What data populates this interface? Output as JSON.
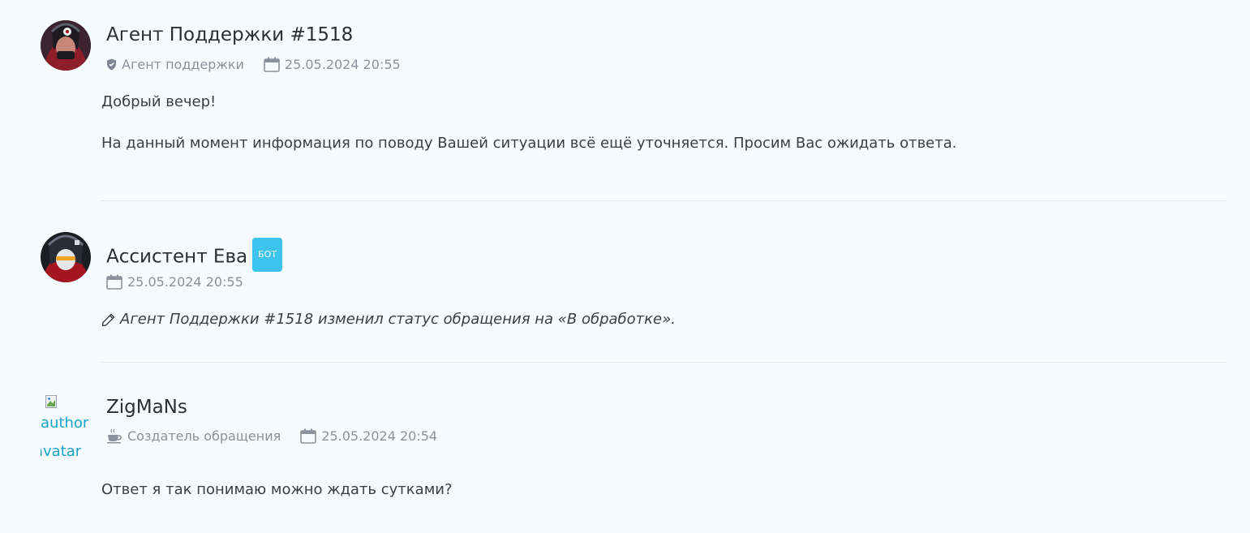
{
  "messages": [
    {
      "author": "Агент Поддержки #1518",
      "role": "Агент поддержки",
      "role_icon": "shield-icon",
      "date": "25.05.2024 20:55",
      "body": [
        "Добрый вечер!",
        "На данный момент информация по поводу Вашей ситуации всё ещё уточняется. Просим Вас ожидать ответа."
      ]
    },
    {
      "author": "Ассистент Ева",
      "badge": "БОТ",
      "date": "25.05.2024 20:55",
      "body": [
        "Агент Поддержки #1518 изменил статус обращения на «В обработке»."
      ]
    },
    {
      "author": "ZigMaNs",
      "role": "Создатель обращения",
      "role_icon": "coffee-icon",
      "date": "25.05.2024 20:54",
      "avatar_alt": [
        "author",
        "avatar"
      ],
      "body": [
        "Ответ я так понимаю можно ждать сутками?"
      ]
    }
  ],
  "colors": {
    "background": "#f6fbfd",
    "bot_badge": "#3cc3ee",
    "meta_text": "#8a929b",
    "broken_alt_text": "#1aa1c8"
  }
}
